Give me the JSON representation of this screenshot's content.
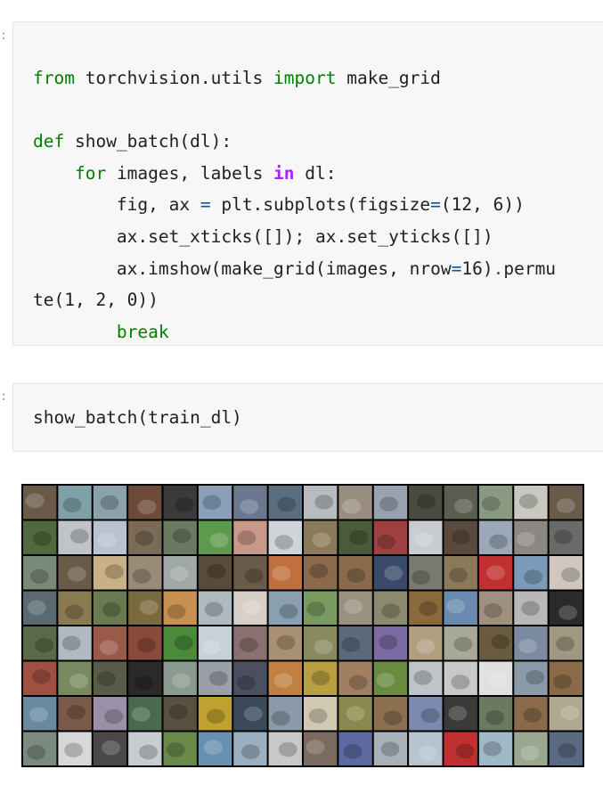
{
  "cells": [
    {
      "prompt": ":",
      "lines": [
        [
          [
            "kw",
            "from"
          ],
          [
            "t",
            " torchvision.utils "
          ],
          [
            "kw",
            "import"
          ],
          [
            "t",
            " make_grid"
          ]
        ],
        [],
        [
          [
            "kw",
            "def"
          ],
          [
            "t",
            " show_batch(dl):"
          ]
        ],
        [
          [
            "t",
            "    "
          ],
          [
            "kw",
            "for"
          ],
          [
            "t",
            " images, labels "
          ],
          [
            "kw2",
            "in"
          ],
          [
            "t",
            " dl:"
          ]
        ],
        [
          [
            "t",
            "        fig, ax "
          ],
          [
            "op",
            "="
          ],
          [
            "t",
            " plt.subplots(figsize"
          ],
          [
            "op",
            "="
          ],
          [
            "t",
            "(12, 6))"
          ]
        ],
        [
          [
            "t",
            "        ax.set_xticks([]); ax.set_yticks([])"
          ]
        ],
        [
          [
            "t",
            "        ax.imshow(make_grid(images, nrow"
          ],
          [
            "op",
            "="
          ],
          [
            "t",
            "16)"
          ],
          [
            "op",
            "."
          ],
          [
            "t",
            "permu"
          ]
        ],
        [
          [
            "t",
            "te(1, 2, 0))"
          ]
        ],
        [
          [
            "t",
            "        "
          ],
          [
            "kw",
            "break"
          ]
        ]
      ]
    },
    {
      "prompt": ":",
      "lines": [
        [
          [
            "t",
            "show_batch(train_dl)"
          ]
        ]
      ]
    }
  ],
  "output": {
    "type": "image-grid",
    "description_label": "make_grid output",
    "columns": 16,
    "rows": 8,
    "tile_colors": [
      "#6b5a48",
      "#7fa0a8",
      "#8aa2ae",
      "#6e4a3a",
      "#3a3a3a",
      "#8aa0b8",
      "#6c7890",
      "#5a6e80",
      "#b8bcc0",
      "#9a8e80",
      "#9aa2b0",
      "#4a4a40",
      "#5a5e50",
      "#8a9a80",
      "#c8c8c0",
      "#6a5a4a",
      "#4e6a3e",
      "#c0c4c8",
      "#b8c2d0",
      "#7a6a56",
      "#6a7a60",
      "#5e9a4e",
      "#c89888",
      "#d0d4d8",
      "#8a7a5a",
      "#4a5a3a",
      "#a04040",
      "#c8ccd0",
      "#5a4a3e",
      "#9aa8b8",
      "#8a8880",
      "#6a6a68",
      "#7a8a78",
      "#6a5a48",
      "#c8b088",
      "#9a8a78",
      "#a0a8a8",
      "#5a4a3a",
      "#6a5a4a",
      "#c07040",
      "#8a6a4a",
      "#8a6a4a",
      "#3a4a6a",
      "#7a7a70",
      "#8a7a5a",
      "#c03030",
      "#7a9ab8",
      "#d0c8c0",
      "#5a6a70",
      "#8a7a50",
      "#6a7a50",
      "#7a6a40",
      "#c89050",
      "#b0b8c0",
      "#d8d0c8",
      "#8aa0b0",
      "#7a9a60",
      "#9a9080",
      "#8a8a70",
      "#8a6a3a",
      "#6a8ab0",
      "#a09080",
      "#b8b8b8",
      "#2a2a28",
      "#5a6a48",
      "#b0b8c0",
      "#9a5a4a",
      "#8a4a3a",
      "#4a8a3a",
      "#c8d0d8",
      "#8a7070",
      "#a89070",
      "#8a8a60",
      "#5a6a7a",
      "#7a6aa0",
      "#b0a080",
      "#a8a898",
      "#6a5a40",
      "#7a8aa0",
      "#a09880",
      "#a05040",
      "#7a8a60",
      "#5a5a48",
      "#2a2a2a",
      "#8a9a90",
      "#9aa0a8",
      "#4a5060",
      "#c08040",
      "#b8a040",
      "#a08060",
      "#6a8a40",
      "#c0c4c8",
      "#c8c8c8",
      "#e0e0e0",
      "#8a9aa8",
      "#8a6a48",
      "#6a8aa0",
      "#7a5a4a",
      "#9a90a8",
      "#4a6a50",
      "#5a5040",
      "#c0a030",
      "#3a4a5a",
      "#8a9aa8",
      "#d0c8b0",
      "#8a8a50",
      "#8a7050",
      "#7a8ab0",
      "#3a3a38",
      "#6a7a60",
      "#8a6a4a",
      "#b0a890",
      "#7a8a80",
      "#d8d8d8",
      "#4a4848",
      "#c8ccd0",
      "#6a8a4a",
      "#6a90b0",
      "#9ab0c0",
      "#c8c8c8",
      "#7a6a60",
      "#5a6aa0",
      "#a8b0b8",
      "#b8c4d0",
      "#c03030",
      "#a0b8c8",
      "#9aa890",
      "#5a6a80"
    ]
  }
}
